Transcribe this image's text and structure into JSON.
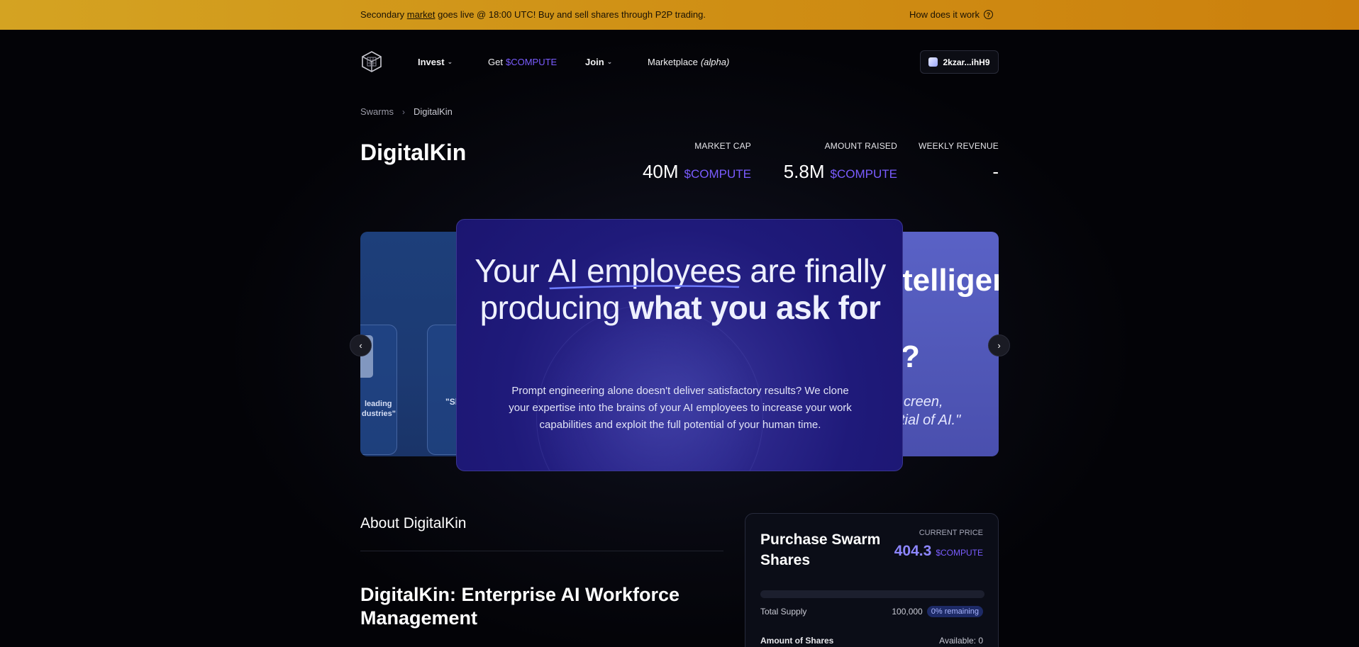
{
  "banner": {
    "text_pre": "Secondary ",
    "text_link": "market",
    "text_post": " goes live @ 18:00 UTC! Buy and sell shares through P2P trading.",
    "help_label": "How does it work",
    "help_icon": "question-circle-icon"
  },
  "nav": {
    "logo_icon": "cube-logo-icon",
    "invest": "Invest",
    "get_pre": "Get",
    "get_token": "$COMPUTE",
    "join": "Join",
    "marketplace": "Marketplace",
    "marketplace_tag": "(alpha)",
    "wallet": "2kzar...ihH9"
  },
  "breadcrumb": {
    "root": "Swarms",
    "current": "DigitalKin"
  },
  "header": {
    "title": "DigitalKin",
    "stats": [
      {
        "label": "MARKET CAP",
        "value": "40M",
        "unit": "$COMPUTE"
      },
      {
        "label": "AMOUNT RAISED",
        "value": "5.8M",
        "unit": "$COMPUTE"
      },
      {
        "label": "WEEKLY REVENUE",
        "value": "-",
        "unit": ""
      }
    ]
  },
  "carousel": {
    "headline_1": "Your ",
    "headline_underlined": "AI employees",
    "headline_2": " are finally producing ",
    "headline_bold": "what you ask for",
    "body": "Prompt engineering alone doesn't deliver satisfactory results? We clone your expertise into the brains of your AI employees to increase your work capabilities and exploit the full potential of your human time.",
    "left_peek_text_1": "leading",
    "left_peek_text_2": "dustries\"",
    "left_peek_quote": "\"Sl",
    "right_peek_big": "telligen",
    "right_peek_q": "?",
    "right_peek_italic_1": "creen,",
    "right_peek_italic_2": "tial of AI.\"",
    "prev_icon": "chevron-left-icon",
    "next_icon": "chevron-right-icon"
  },
  "about": {
    "title": "About DigitalKin",
    "article_title": "DigitalKin: Enterprise AI Workforce Management"
  },
  "purchase": {
    "title": "Purchase Swarm Shares",
    "price_label": "CURRENT PRICE",
    "price_value": "404.3",
    "price_unit": "$COMPUTE",
    "progress_fraction": 0,
    "supply_label": "Total Supply",
    "supply_value": "100,000",
    "remaining": "0% remaining",
    "amount_label": "Amount of Shares",
    "available": "Available: 0"
  },
  "colors": {
    "banner": "#d4a322",
    "accent_purple": "#7a5cff",
    "price_purple": "#8d86ff",
    "card_main": "#1f1a7a",
    "card_left": "#1d3f7a",
    "card_right": "#5a62c6"
  }
}
